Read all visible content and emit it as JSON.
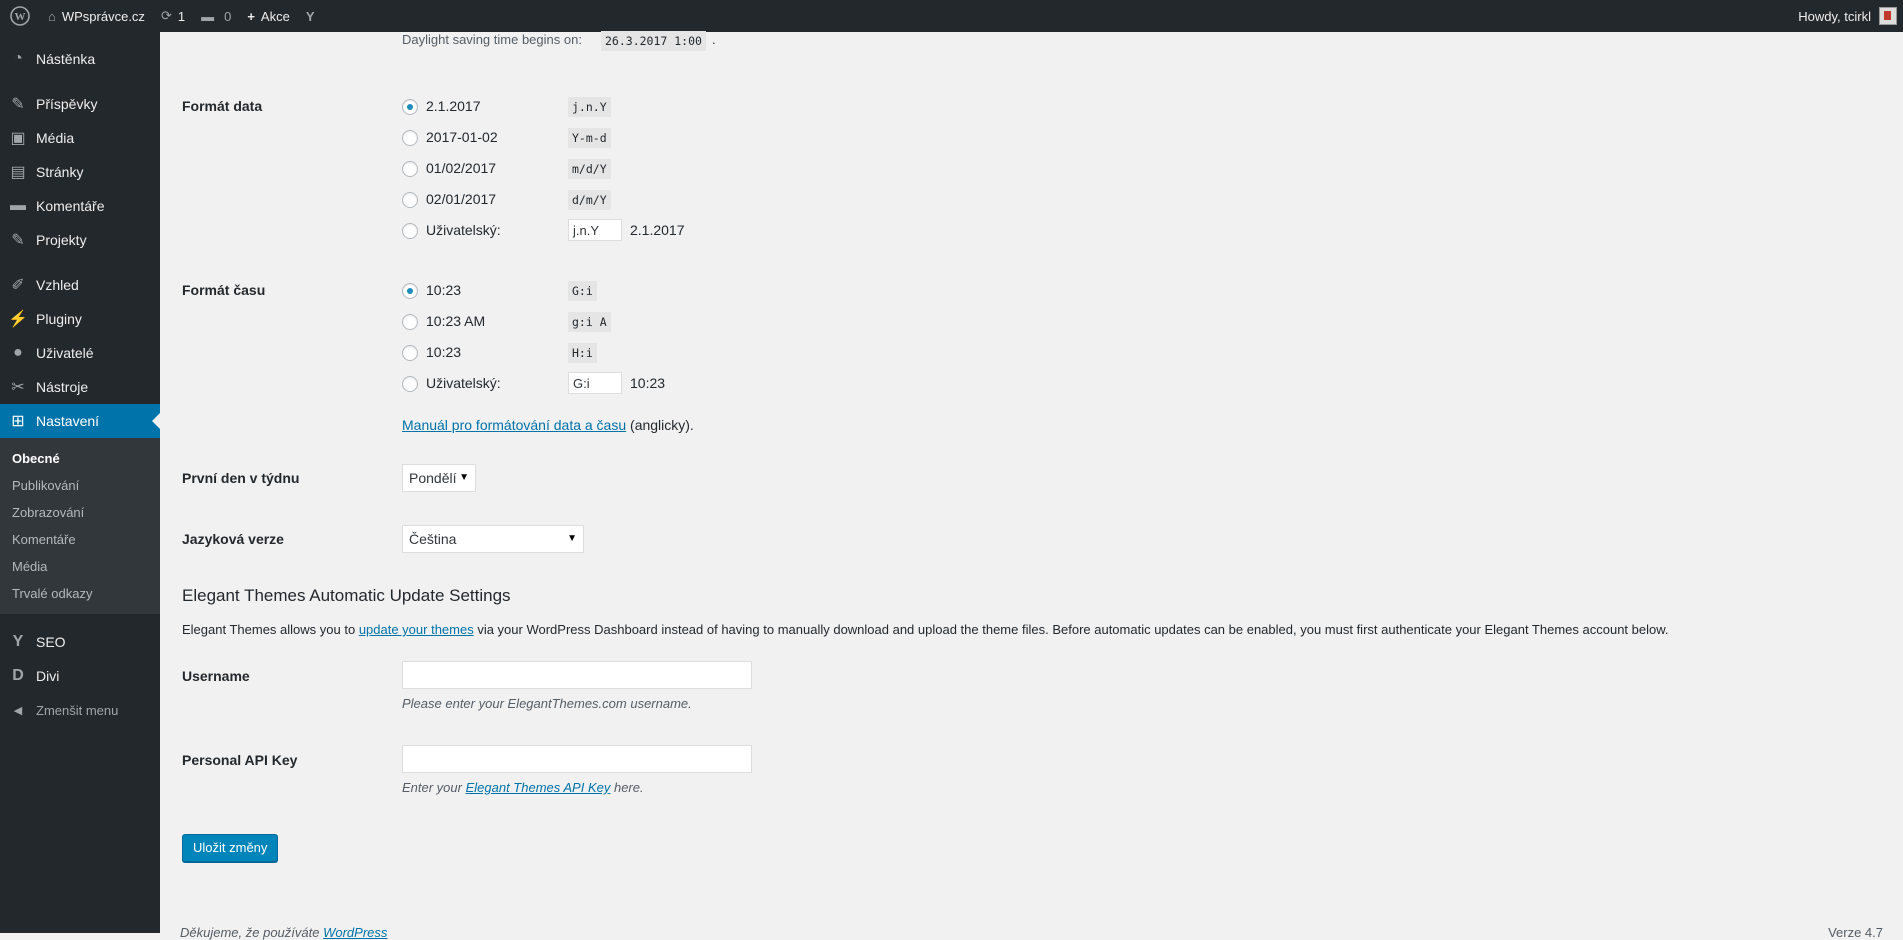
{
  "adminbar": {
    "site_name": "WPsprávce.cz",
    "updates_count": "1",
    "comments_count": "0",
    "new_label": "Akce",
    "howdy": "Howdy, tcirkl"
  },
  "sidebar": {
    "items": [
      {
        "label": "Nástěnka",
        "icon": "dashboard-icon",
        "glyph": "◔"
      },
      {
        "label": "Příspěvky",
        "icon": "pin-icon",
        "glyph": "✎"
      },
      {
        "label": "Média",
        "icon": "media-icon",
        "glyph": "▣"
      },
      {
        "label": "Stránky",
        "icon": "pages-icon",
        "glyph": "▤"
      },
      {
        "label": "Komentáře",
        "icon": "comments-icon",
        "glyph": "▬"
      },
      {
        "label": "Projekty",
        "icon": "pin-icon",
        "glyph": "✎"
      },
      {
        "label": "Vzhled",
        "icon": "appearance-icon",
        "glyph": "✐"
      },
      {
        "label": "Pluginy",
        "icon": "plugins-icon",
        "glyph": "⚡"
      },
      {
        "label": "Uživatelé",
        "icon": "users-icon",
        "glyph": "●"
      },
      {
        "label": "Nástroje",
        "icon": "tools-icon",
        "glyph": "✂"
      },
      {
        "label": "Nastavení",
        "icon": "settings-icon",
        "glyph": "⊞"
      }
    ],
    "submenu": [
      "Obecné",
      "Publikování",
      "Zobrazování",
      "Komentáře",
      "Média",
      "Trvalé odkazy"
    ],
    "extra": [
      {
        "label": "SEO",
        "icon": "yoast-icon",
        "glyph": "Y"
      },
      {
        "label": "Divi",
        "icon": "divi-icon",
        "glyph": "D"
      }
    ],
    "collapse_label": "Zmenšit menu"
  },
  "dst": {
    "text": "Daylight saving time begins on:",
    "value": "26.3.2017 1:00",
    "suffix": "."
  },
  "date_format": {
    "label": "Formát data",
    "options": [
      {
        "label": "2.1.2017",
        "code": "j.n.Y",
        "checked": true
      },
      {
        "label": "2017-01-02",
        "code": "Y-m-d",
        "checked": false
      },
      {
        "label": "01/02/2017",
        "code": "m/d/Y",
        "checked": false
      },
      {
        "label": "02/01/2017",
        "code": "d/m/Y",
        "checked": false
      }
    ],
    "custom_label": "Uživatelský:",
    "custom_value": "j.n.Y",
    "custom_preview": "2.1.2017"
  },
  "time_format": {
    "label": "Formát času",
    "options": [
      {
        "label": "10:23",
        "code": "G:i",
        "checked": true
      },
      {
        "label": "10:23 AM",
        "code": "g:i A",
        "checked": false
      },
      {
        "label": "10:23",
        "code": "H:i",
        "checked": false
      }
    ],
    "custom_label": "Uživatelský:",
    "custom_value": "G:i",
    "custom_preview": "10:23"
  },
  "manual": {
    "link": "Manuál pro formátování data a času",
    "suffix": " (anglicky)."
  },
  "week": {
    "label": "První den v týdnu",
    "value": "Pondělí"
  },
  "language": {
    "label": "Jazyková verze",
    "value": "Čeština"
  },
  "elegant": {
    "heading": "Elegant Themes Automatic Update Settings",
    "desc_prefix": "Elegant Themes allows you to ",
    "desc_link": "update your themes",
    "desc_suffix": " via your WordPress Dashboard instead of having to manually download and upload the theme files. Before automatic updates can be enabled, you must first authenticate your Elegant Themes account below.",
    "username_label": "Username",
    "username_desc": "Please enter your ElegantThemes.com username.",
    "api_label": "Personal API Key",
    "api_desc_prefix": "Enter your ",
    "api_desc_link": "Elegant Themes API Key",
    "api_desc_suffix": " here."
  },
  "save_label": "Uložit změny",
  "footer": {
    "thanks": "Děkujeme, že používáte",
    "wp_link": "WordPress",
    "version": "Verze 4.7"
  }
}
